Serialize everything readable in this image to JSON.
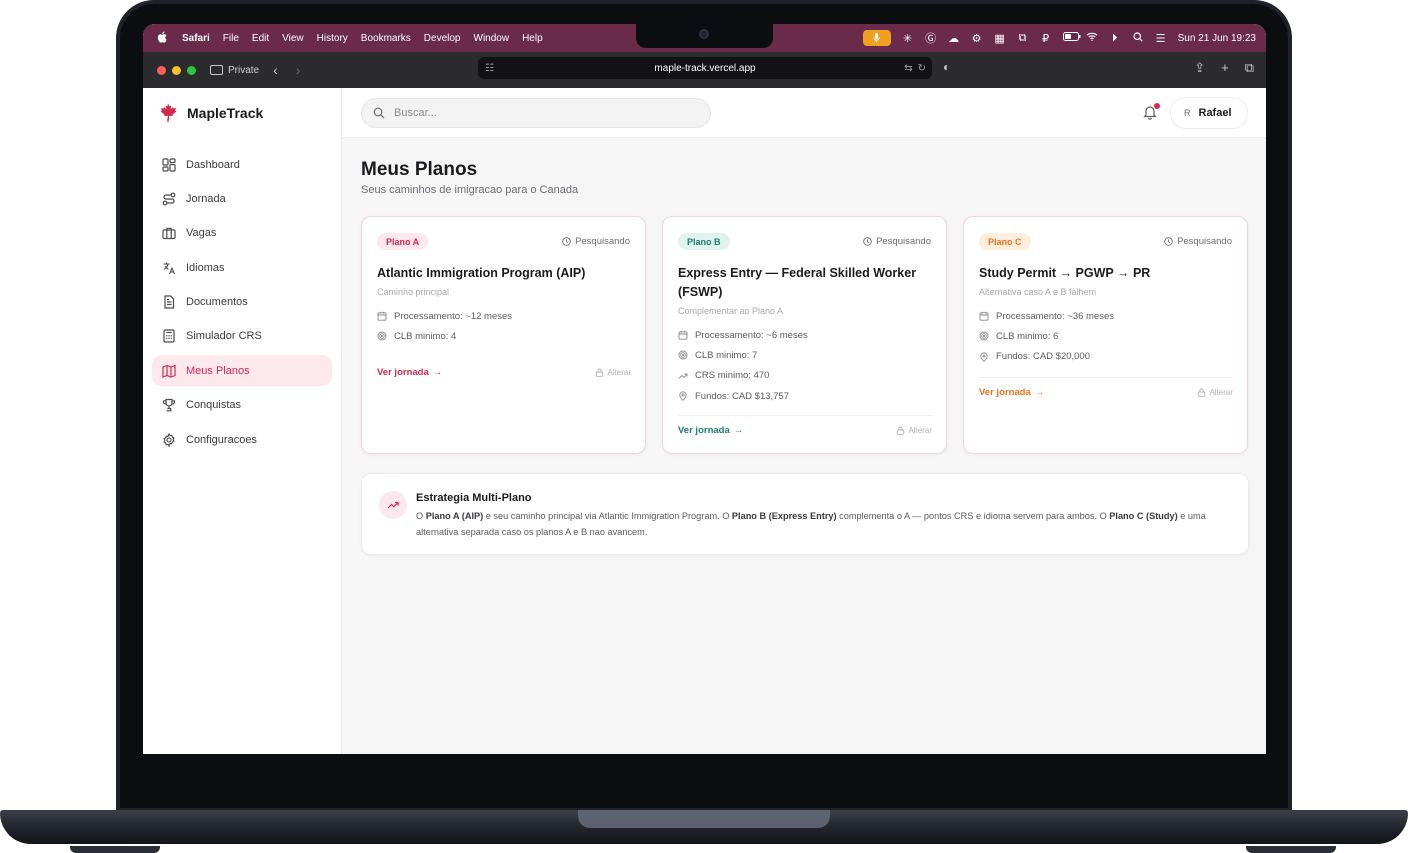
{
  "menubar": {
    "app": "Safari",
    "items": [
      "File",
      "Edit",
      "View",
      "History",
      "Bookmarks",
      "Develop",
      "Window",
      "Help"
    ],
    "datetime": "Sun 21 Jun  19:23"
  },
  "browser": {
    "private_label": "Private",
    "url": "maple-track.vercel.app"
  },
  "brand": {
    "name": "MapleTrack",
    "color": "#d22a4f"
  },
  "sidebar": {
    "items": [
      {
        "label": "Dashboard",
        "icon": "dashboard-icon"
      },
      {
        "label": "Jornada",
        "icon": "route-icon"
      },
      {
        "label": "Vagas",
        "icon": "briefcase-icon"
      },
      {
        "label": "Idiomas",
        "icon": "translate-icon"
      },
      {
        "label": "Documentos",
        "icon": "document-icon"
      },
      {
        "label": "Simulador CRS",
        "icon": "calculator-icon"
      },
      {
        "label": "Meus Planos",
        "icon": "map-icon",
        "active": true
      },
      {
        "label": "Conquistas",
        "icon": "trophy-icon"
      },
      {
        "label": "Configuracoes",
        "icon": "gear-icon"
      }
    ]
  },
  "topbar": {
    "search_placeholder": "Buscar...",
    "user_initial": "R",
    "user_name": "Rafael"
  },
  "page": {
    "title": "Meus Planos",
    "subtitle": "Seus caminhos de imigracao para o Canada"
  },
  "plans": [
    {
      "badge": "Plano A",
      "badge_color": "#d22a4f",
      "badge_bg": "#fde8ee",
      "status": "Pesquisando",
      "title": "Atlantic Immigration Program (AIP)",
      "subtitle": "Caminho principal",
      "facts": [
        {
          "icon": "calendar-icon",
          "text": "Processamento: ~12 meses"
        },
        {
          "icon": "target-icon",
          "text": "CLB minimo: 4"
        }
      ],
      "cta": "Ver jornada",
      "alterar": "Alterar"
    },
    {
      "badge": "Plano B",
      "badge_color": "#1d7f6e",
      "badge_bg": "#e0f3ee",
      "status": "Pesquisando",
      "title": "Express Entry — Federal Skilled Worker (FSWP)",
      "subtitle": "Complementar ao Plano A",
      "facts": [
        {
          "icon": "calendar-icon",
          "text": "Processamento: ~6 meses"
        },
        {
          "icon": "target-icon",
          "text": "CLB minimo: 7"
        },
        {
          "icon": "trending-icon",
          "text": "CRS minimo: 470"
        },
        {
          "icon": "pin-icon",
          "text": "Fundos: CAD $13,757"
        }
      ],
      "cta": "Ver jornada",
      "alterar": "Alterar"
    },
    {
      "badge": "Plano C",
      "badge_color": "#e8731f",
      "badge_bg": "#fdeede",
      "status": "Pesquisando",
      "title": "Study Permit → PGWP → PR",
      "subtitle": "Alternativa caso A e B falhem",
      "facts": [
        {
          "icon": "calendar-icon",
          "text": "Processamento: ~36 meses"
        },
        {
          "icon": "target-icon",
          "text": "CLB minimo: 6"
        },
        {
          "icon": "pin-icon",
          "text": "Fundos: CAD $20,000"
        }
      ],
      "cta": "Ver jornada",
      "alterar": "Alterar"
    }
  ],
  "strategy": {
    "title": "Estrategia Multi-Plano",
    "p1": "O ",
    "b1": "Plano A (AIP)",
    "p2": " e seu caminho principal via Atlantic Immigration Program. O ",
    "b2": "Plano B (Express Entry)",
    "p3": " complementa o A — pontos CRS e idioma servem para ambos. O ",
    "b3": "Plano C (Study)",
    "p4": " e uma alternativa separada caso os planos A e B nao avancem."
  }
}
